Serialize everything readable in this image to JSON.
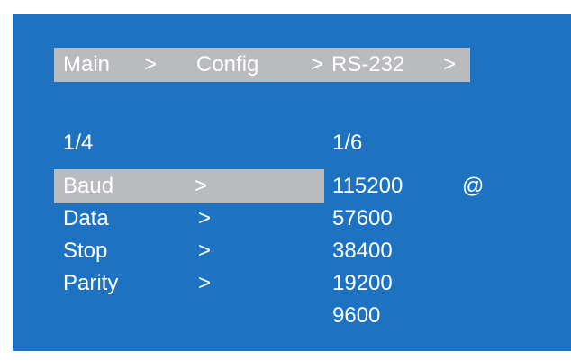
{
  "breadcrumb": {
    "items": [
      "Main",
      "Config",
      "RS-232"
    ],
    "separator": ">"
  },
  "left_menu": {
    "page_indicator": "1/4",
    "items": [
      {
        "label": "Baud",
        "arrow": ">",
        "selected": true
      },
      {
        "label": "Data",
        "arrow": ">",
        "selected": false
      },
      {
        "label": "Stop",
        "arrow": ">",
        "selected": false
      },
      {
        "label": "Parity",
        "arrow": ">",
        "selected": false
      }
    ]
  },
  "right_menu": {
    "page_indicator": "1/6",
    "options": [
      "115200",
      "57600",
      "38400",
      "19200",
      "9600"
    ],
    "current_marker": "@",
    "current_index": 0
  },
  "colors": {
    "screen_background": "#1d72c1",
    "highlight": "#b9bbbe",
    "text": "#ffffff"
  }
}
